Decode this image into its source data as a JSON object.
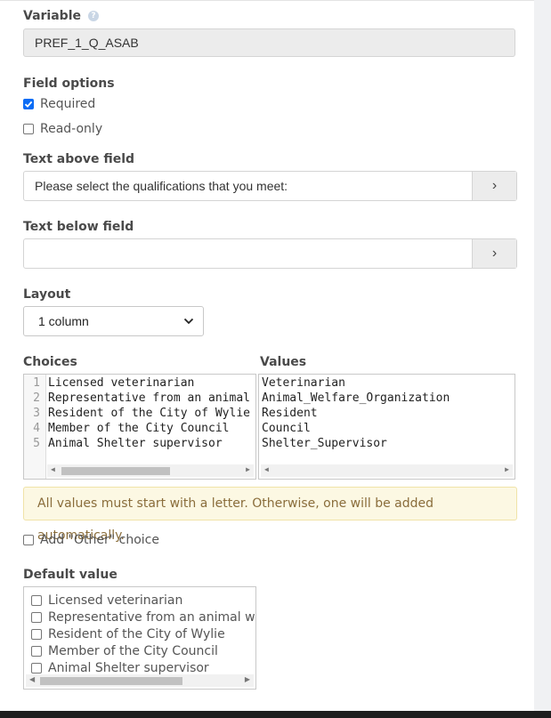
{
  "variable": {
    "label": "Variable",
    "help_icon": "?",
    "value": "PREF_1_Q_ASAB"
  },
  "field_options": {
    "label": "Field options",
    "required": {
      "label": "Required",
      "checked": true
    },
    "readonly": {
      "label": "Read-only",
      "checked": false
    }
  },
  "text_above": {
    "label": "Text above field",
    "value": "Please select the qualifications that you meet:",
    "button": "›"
  },
  "text_below": {
    "label": "Text below field",
    "value": "",
    "button": "›"
  },
  "layout": {
    "label": "Layout",
    "selected": "1 column",
    "arrow": "⌄"
  },
  "choices": {
    "label": "Choices",
    "line_numbers": [
      "1",
      "2",
      "3",
      "4",
      "5"
    ],
    "items": [
      "Licensed veterinarian",
      "Representative from an animal w",
      "Resident of the City of Wylie",
      "Member of the City Council",
      "Animal Shelter supervisor"
    ]
  },
  "values": {
    "label": "Values",
    "items": [
      "Veterinarian",
      "Animal_Welfare_Organization",
      "Resident",
      "Council",
      "Shelter_Supervisor"
    ]
  },
  "notice": "All values must start with a letter. Otherwise, one will be added automatically.",
  "other_choice": {
    "label": "Add \"Other\" choice",
    "checked": false
  },
  "default_value": {
    "label": "Default value",
    "items": [
      "Licensed veterinarian",
      "Representative from an animal welf",
      "Resident of the City of Wylie",
      "Member of the City Council",
      "Animal Shelter supervisor"
    ]
  },
  "scroll_arrows": {
    "left": "◀",
    "right": "▶"
  },
  "colors": {
    "accent": "#0b6cf5",
    "notice_bg": "#fcf8e3",
    "notice_text": "#8a6d3b"
  }
}
